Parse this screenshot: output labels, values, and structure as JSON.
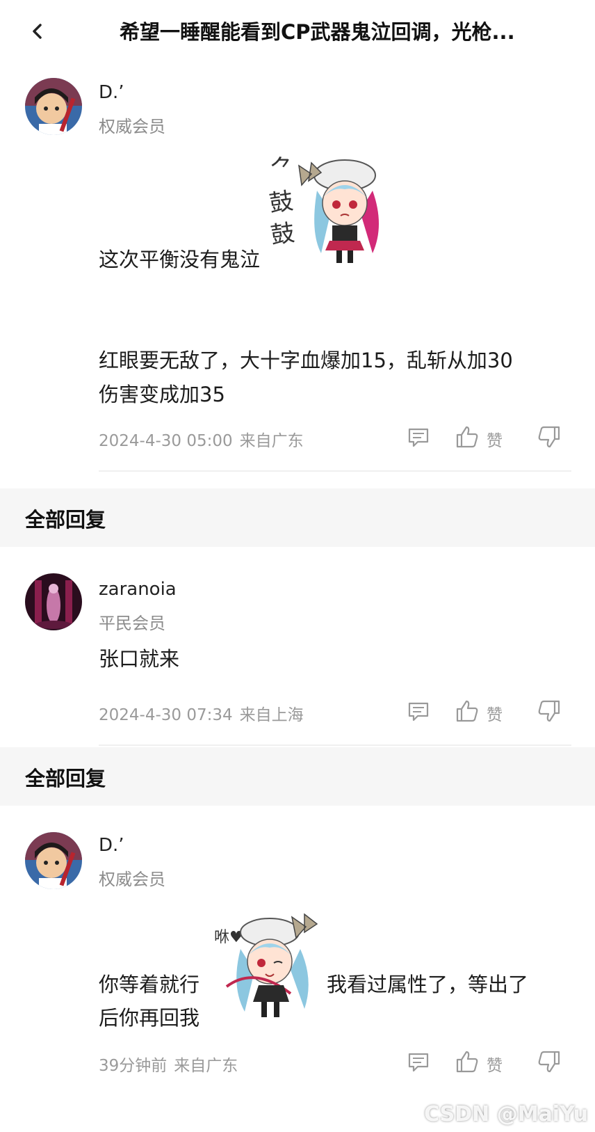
{
  "header": {
    "back_icon": "chevron-left-icon",
    "title": "希望一睡醒能看到CP武器鬼泣回调，光枪..."
  },
  "posts": [
    {
      "username": "D.’",
      "level": "权威会员",
      "text_line1": "这次平衡没有鬼泣",
      "text_line2": "红眼要无敌了，大十字血爆加15，乱斩从加30",
      "text_line3": "伤害变成加35",
      "sticker_text": "气鼓鼓",
      "timestamp": "2024-4-30 05:00",
      "location": "来自广东",
      "like_label": "赞"
    },
    {
      "username": "zaranoia",
      "level": "平民会员",
      "text_line1": "张口就来",
      "timestamp": "2024-4-30 07:34",
      "location": "来自上海",
      "like_label": "赞"
    },
    {
      "username": "D.’",
      "level": "权威会员",
      "text_line1a": "你等着就行",
      "text_line1b": "我看过属性了，等出了",
      "text_line2": "后你再回我",
      "sticker_text": "咻♥",
      "timestamp": "39分钟前",
      "location": "来自广东",
      "like_label": "赞"
    }
  ],
  "sections": [
    {
      "title": "全部回复"
    },
    {
      "title": "全部回复"
    }
  ],
  "watermark": "CSDN @MaiYu",
  "colors": {
    "text": "#1c1c1c",
    "muted": "#9a9a9a",
    "section_bg": "#f6f6f6"
  }
}
